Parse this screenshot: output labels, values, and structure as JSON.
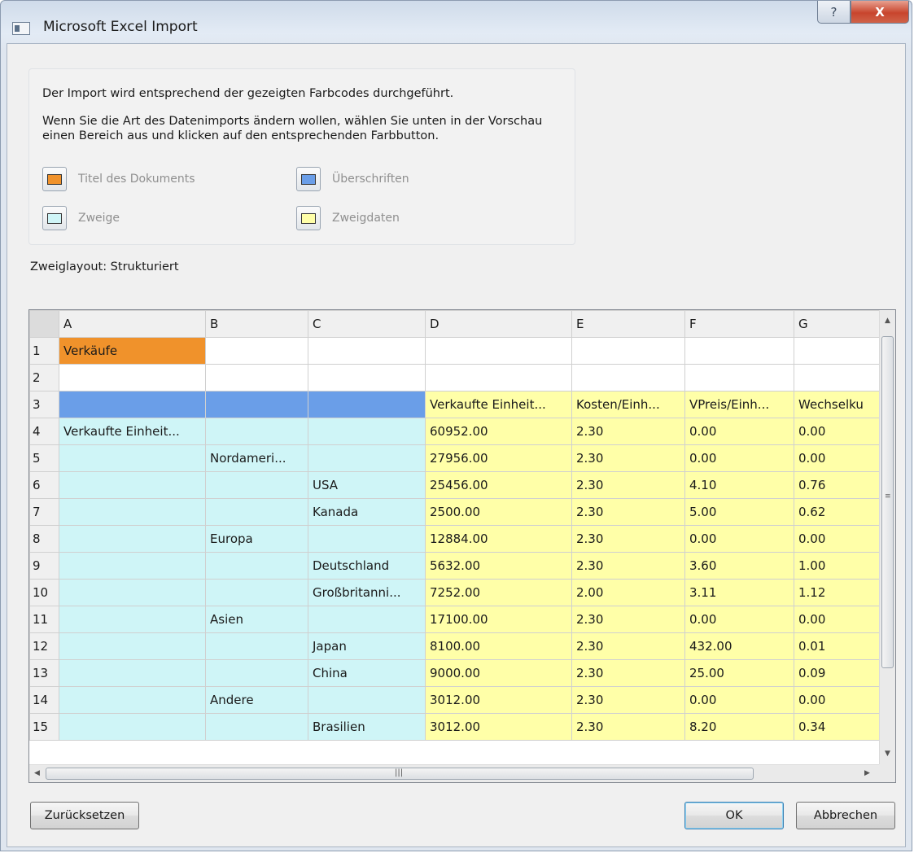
{
  "window": {
    "title": "Microsoft Excel Import",
    "help_glyph": "?",
    "close_glyph": "X"
  },
  "info": {
    "line1": "Der Import wird entsprechend der gezeigten Farbcodes durchgeführt.",
    "line2": "Wenn Sie die Art des Datenimports ändern wollen, wählen Sie unten in der Vorschau einen Bereich aus und klicken auf den entsprechenden Farbbutton."
  },
  "legend": [
    {
      "label": "Titel des Dokuments",
      "color": "#f0922b"
    },
    {
      "label": "Überschriften",
      "color": "#6a9ee8"
    },
    {
      "label": "Zweige",
      "color": "#cff5f7"
    },
    {
      "label": "Zweigdaten",
      "color": "#ffffa8"
    }
  ],
  "layout_label": "Zweiglayout: Strukturiert",
  "grid": {
    "columns": [
      "A",
      "B",
      "C",
      "D",
      "E",
      "F",
      "G"
    ],
    "rows": [
      {
        "num": "1",
        "cells": [
          "Verkäufe",
          "",
          "",
          "",
          "",
          "",
          ""
        ]
      },
      {
        "num": "2",
        "cells": [
          "",
          "",
          "",
          "",
          "",
          "",
          ""
        ]
      },
      {
        "num": "3",
        "cells": [
          "",
          "",
          "",
          "Verkaufte Einheit...",
          "Kosten/Einh...",
          "VPreis/Einh...",
          "Wechselku"
        ]
      },
      {
        "num": "4",
        "cells": [
          "Verkaufte Einheit...",
          "",
          "",
          "60952.00",
          "2.30",
          "0.00",
          "0.00"
        ]
      },
      {
        "num": "5",
        "cells": [
          "",
          "Nordameri...",
          "",
          "27956.00",
          "2.30",
          "0.00",
          "0.00"
        ]
      },
      {
        "num": "6",
        "cells": [
          "",
          "",
          "USA",
          "25456.00",
          "2.30",
          "4.10",
          "0.76"
        ]
      },
      {
        "num": "7",
        "cells": [
          "",
          "",
          "Kanada",
          "2500.00",
          "2.30",
          "5.00",
          "0.62"
        ]
      },
      {
        "num": "8",
        "cells": [
          "",
          "Europa",
          "",
          "12884.00",
          "2.30",
          "0.00",
          "0.00"
        ]
      },
      {
        "num": "9",
        "cells": [
          "",
          "",
          "Deutschland",
          "5632.00",
          "2.30",
          "3.60",
          "1.00"
        ]
      },
      {
        "num": "10",
        "cells": [
          "",
          "",
          "Großbritanni...",
          "7252.00",
          "2.00",
          "3.11",
          "1.12"
        ]
      },
      {
        "num": "11",
        "cells": [
          "",
          "Asien",
          "",
          "17100.00",
          "2.30",
          "0.00",
          "0.00"
        ]
      },
      {
        "num": "12",
        "cells": [
          "",
          "",
          "Japan",
          "8100.00",
          "2.30",
          "432.00",
          "0.01"
        ]
      },
      {
        "num": "13",
        "cells": [
          "",
          "",
          "China",
          "9000.00",
          "2.30",
          "25.00",
          "0.09"
        ]
      },
      {
        "num": "14",
        "cells": [
          "",
          "Andere",
          "",
          "3012.00",
          "2.30",
          "0.00",
          "0.00"
        ]
      },
      {
        "num": "15",
        "cells": [
          "",
          "",
          "Brasilien",
          "3012.00",
          "2.30",
          "8.20",
          "0.34"
        ]
      }
    ]
  },
  "buttons": {
    "reset": "Zurücksetzen",
    "ok": "OK",
    "cancel": "Abbrechen"
  }
}
